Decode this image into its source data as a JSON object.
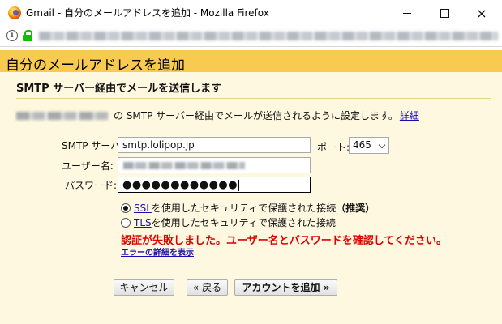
{
  "window": {
    "title": "Gmail - 自分のメールアドレスを追加 - Mozilla Firefox",
    "controls": {
      "minimize": "minimize",
      "maximize": "maximize",
      "close": "×"
    }
  },
  "urlbar": {
    "info_glyph": "i"
  },
  "dialog": {
    "heading": "自分のメールアドレスを追加",
    "subheading": "SMTP サーバー経由でメールを送信します",
    "description": "の SMTP サーバー経由でメールが送信されるように設定します。",
    "detail_link": "詳細",
    "labels": {
      "smtp_server": "SMTP サーバー:",
      "username": "ユーザー名:",
      "password": "パスワード:",
      "port": "ポート:"
    },
    "fields": {
      "smtp_server_value": "smtp.lolipop.jp",
      "password_dots": "●●●●●●●●●●●●"
    },
    "port": {
      "selected": "465"
    },
    "security": {
      "ssl_link": "SSL",
      "ssl_text": " を使用したセキュリティで保護された接続",
      "ssl_recommend": "（推奨）",
      "tls_link": "TLS",
      "tls_text": " を使用したセキュリティで保護された接続",
      "selected": "SSL"
    },
    "error": {
      "message": "認証が失敗しました。ユーザー名とパスワードを確認してください。",
      "details_link": "エラーの詳細を表示"
    },
    "buttons": {
      "cancel": "キャンセル",
      "back": "« 戻る",
      "add_account": "アカウントを追加 »"
    }
  },
  "colors": {
    "heading_bg": "#f8ca4f",
    "panel_bg": "#fff8e1",
    "error": "#e00000",
    "link": "#1a0dab",
    "lock_green": "#12bc00"
  }
}
